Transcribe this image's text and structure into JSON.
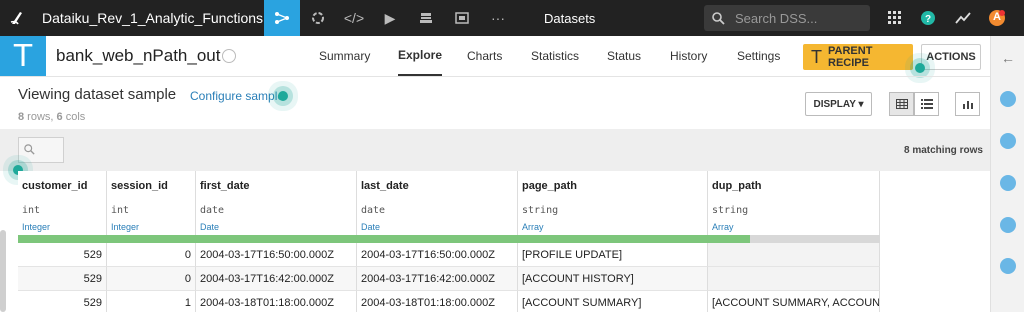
{
  "topbar": {
    "project_name": "Dataiku_Rev_1_Analytic_Functions",
    "nav_icons": [
      "flow-icon",
      "recipes-icon",
      "code-icon",
      "run-icon",
      "deploy-icon",
      "dashboard-icon",
      "more-icon"
    ],
    "current_section": "Datasets",
    "search_placeholder": "Search DSS...",
    "avatar_letter": "A"
  },
  "dataset": {
    "icon_letter": "T",
    "name": "bank_web_nPath_out"
  },
  "tabs": [
    {
      "label": "Summary"
    },
    {
      "label": "Explore"
    },
    {
      "label": "Charts"
    },
    {
      "label": "Statistics"
    },
    {
      "label": "Status"
    },
    {
      "label": "History"
    },
    {
      "label": "Settings"
    }
  ],
  "active_tab": "Explore",
  "buttons": {
    "parent_recipe_icon": "T",
    "parent_recipe": "PARENT RECIPE",
    "actions": "ACTIONS",
    "display": "DISPLAY ▾"
  },
  "sample": {
    "title": "Viewing dataset sample",
    "configure_link": "Configure sample",
    "rows_count": "8",
    "rows_label": " rows,",
    "cols_count": "6",
    "cols_label": " cols"
  },
  "matching_rows": "8 matching rows",
  "columns": [
    {
      "name": "customer_id",
      "type": "int",
      "meaning": "Integer"
    },
    {
      "name": "session_id",
      "type": "int",
      "meaning": "Integer"
    },
    {
      "name": "first_date",
      "type": "date",
      "meaning": "Date"
    },
    {
      "name": "last_date",
      "type": "date",
      "meaning": "Date"
    },
    {
      "name": "page_path",
      "type": "string",
      "meaning": "Array"
    },
    {
      "name": "dup_path",
      "type": "string",
      "meaning": "Array"
    }
  ],
  "rows": [
    [
      "529",
      "0",
      "2004-03-17T16:50:00.000Z",
      "2004-03-17T16:50:00.000Z",
      "[PROFILE UPDATE]",
      ""
    ],
    [
      "529",
      "0",
      "2004-03-17T16:42:00.000Z",
      "2004-03-17T16:42:00.000Z",
      "[ACCOUNT HISTORY]",
      ""
    ],
    [
      "529",
      "1",
      "2004-03-18T01:18:00.000Z",
      "2004-03-18T01:18:00.000Z",
      "[ACCOUNT SUMMARY]",
      "[ACCOUNT SUMMARY, ACCOUNT…"
    ]
  ],
  "colors": {
    "accent_blue": "#2aa3e0",
    "parent_recipe": "#f5b731",
    "quality_valid": "#7dc67b",
    "link": "#2a7fb8"
  }
}
